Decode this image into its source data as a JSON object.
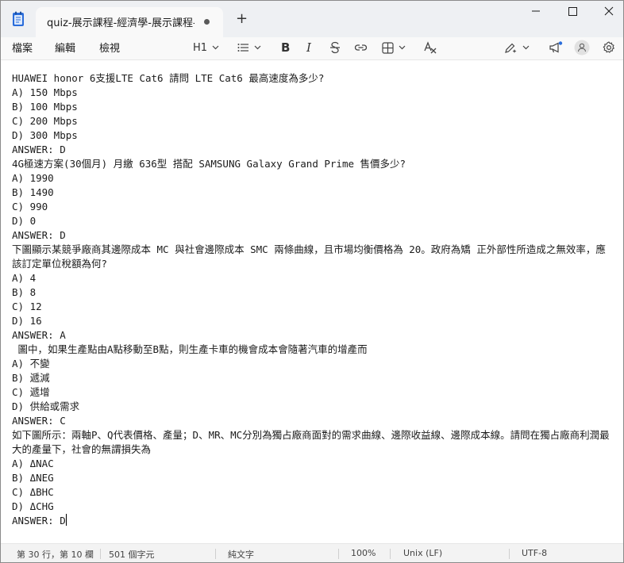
{
  "window": {
    "tab_title": "quiz-展示課程-經濟學-展示課程-經濟",
    "new_tab": "+"
  },
  "menu": {
    "file": "檔案",
    "edit": "編輯",
    "view": "檢視"
  },
  "toolbar": {
    "heading": "H1",
    "bold": "B",
    "italic": "I"
  },
  "editor": {
    "lines": [
      "HUAWEI honor 6支援LTE Cat6 請問 LTE Cat6 最高速度為多少?",
      "A) 150 Mbps",
      "B) 100 Mbps",
      "C) 200 Mbps",
      "D) 300 Mbps",
      "ANSWER: D",
      "4G極速方案(30個月) 月繳 636型 搭配 SAMSUNG Galaxy Grand Prime 售價多少?",
      "A) 1990",
      "B) 1490",
      "C) 990",
      "D) 0",
      "ANSWER: D",
      "下圖顯示某競爭廠商其邊際成本 MC 與社會邊際成本 SMC 兩條曲線，且市場均衡價格為 20。政府為矯 正外部性所造成之無效率，應該訂定單位稅額為何?",
      "A) 4",
      "B) 8",
      "C) 12",
      "D) 16",
      "ANSWER: A",
      " 圖中，如果生產點由A點移動至B點，則生產卡車的機會成本會隨著汽車的增產而",
      "A) 不變",
      "B) 遞減",
      "C) 遞增",
      "D) 供給或需求",
      "ANSWER: C",
      "如下圖所示：兩軸P、Q代表價格、產量；D、MR、MC分別為獨占廠商面對的需求曲線、邊際收益線、邊際成本線。請問在獨占廠商利潤最大的產量下，社會的無謂損失為",
      "A) ΔNAC",
      "B) ΔNEG",
      "C) ΔBHC",
      "D) ΔCHG",
      "ANSWER: D"
    ]
  },
  "status": {
    "position": "第 30 行，第 10 欄",
    "chars": "501 個字元",
    "format": "純文字",
    "zoom": "100%",
    "line_ending": "Unix (LF)",
    "encoding": "UTF-8"
  },
  "colors": {
    "accent": "#2a6ddb",
    "titlebar": "#eef0f3",
    "editor_bg": "#ffffff"
  }
}
